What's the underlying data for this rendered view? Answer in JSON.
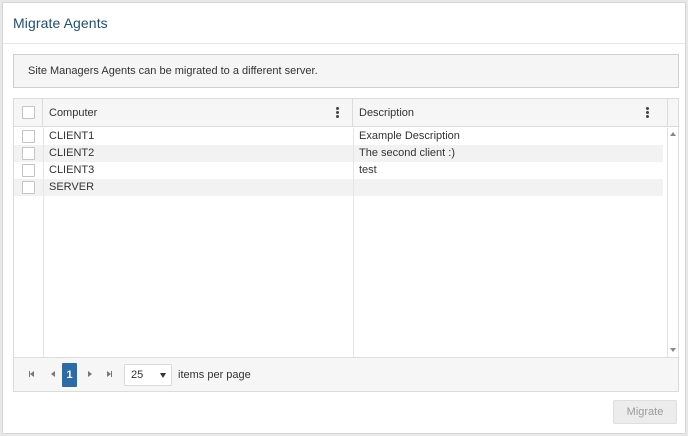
{
  "dialog": {
    "title": "Migrate Agents",
    "info_text": "Site Managers Agents can be migrated to a different server."
  },
  "grid": {
    "columns": [
      {
        "label": "Computer"
      },
      {
        "label": "Description"
      }
    ],
    "rows": [
      {
        "computer": "CLIENT1",
        "description": "Example Description"
      },
      {
        "computer": "CLIENT2",
        "description": "The second client :)"
      },
      {
        "computer": "CLIENT3",
        "description": "test"
      },
      {
        "computer": "SERVER",
        "description": ""
      }
    ]
  },
  "pager": {
    "current_page": "1",
    "page_size": "25",
    "items_per_page_label": "items per page"
  },
  "actions": {
    "migrate_label": "Migrate"
  },
  "colors": {
    "accent": "#2a6ba8",
    "title": "#1f4e79"
  }
}
